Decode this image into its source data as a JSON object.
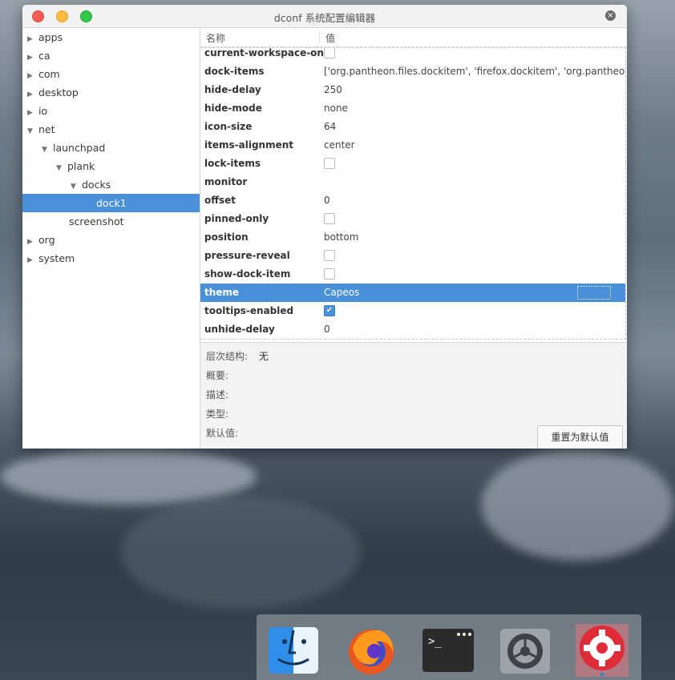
{
  "window": {
    "title": "dconf 系统配置编辑器",
    "close_glyph": "×"
  },
  "tree": [
    {
      "label": "apps",
      "arrow": "▶"
    },
    {
      "label": "ca",
      "arrow": "▶"
    },
    {
      "label": "com",
      "arrow": "▶"
    },
    {
      "label": "desktop",
      "arrow": "▶"
    },
    {
      "label": "io",
      "arrow": "▶"
    },
    {
      "label": "net",
      "arrow": "▼"
    },
    {
      "label": "launchpad",
      "arrow": "▼"
    },
    {
      "label": "plank",
      "arrow": "▼"
    },
    {
      "label": "docks",
      "arrow": "▼"
    },
    {
      "label": "dock1",
      "arrow": ""
    },
    {
      "label": "screenshot",
      "arrow": ""
    },
    {
      "label": "org",
      "arrow": "▶"
    },
    {
      "label": "system",
      "arrow": "▶"
    }
  ],
  "columns": {
    "name": "名称",
    "value": "值"
  },
  "keys": [
    {
      "name": "current-workspace-only",
      "value": "",
      "type": "bool",
      "checked": false
    },
    {
      "name": "dock-items",
      "value": "['org.pantheon.files.dockitem', 'firefox.dockitem', 'org.pantheon.terminal.dockitem', 'org.pantheon.switchboard.dockitem']",
      "type": "text"
    },
    {
      "name": "hide-delay",
      "value": "250",
      "type": "text"
    },
    {
      "name": "hide-mode",
      "value": "none",
      "type": "text"
    },
    {
      "name": "icon-size",
      "value": "64",
      "type": "text"
    },
    {
      "name": "items-alignment",
      "value": "center",
      "type": "text"
    },
    {
      "name": "lock-items",
      "value": "",
      "type": "bool",
      "checked": false
    },
    {
      "name": "monitor",
      "value": "",
      "type": "text"
    },
    {
      "name": "offset",
      "value": "0",
      "type": "text"
    },
    {
      "name": "pinned-only",
      "value": "",
      "type": "bool",
      "checked": false
    },
    {
      "name": "position",
      "value": "bottom",
      "type": "text"
    },
    {
      "name": "pressure-reveal",
      "value": "",
      "type": "bool",
      "checked": false
    },
    {
      "name": "show-dock-item",
      "value": "",
      "type": "bool",
      "checked": false
    },
    {
      "name": "theme",
      "value": "Capeos",
      "type": "text"
    },
    {
      "name": "tooltips-enabled",
      "value": "",
      "type": "bool",
      "checked": true
    },
    {
      "name": "unhide-delay",
      "value": "0",
      "type": "text"
    }
  ],
  "details": {
    "hierarchy_label": "层次结构:",
    "hierarchy_value": "无",
    "summary_label": "概要:",
    "description_label": "描述:",
    "type_label": "类型:",
    "default_label": "默认值:",
    "reset_button": "重置为默认值"
  },
  "dock": {
    "items": [
      "finder-icon",
      "firefox-icon",
      "terminal-icon",
      "system-settings-icon",
      "dconf-editor-icon"
    ]
  },
  "colors": {
    "selection": "#4a90d9",
    "close": "#fb5c55",
    "minimize": "#fdbc40",
    "maximize": "#33c748"
  }
}
